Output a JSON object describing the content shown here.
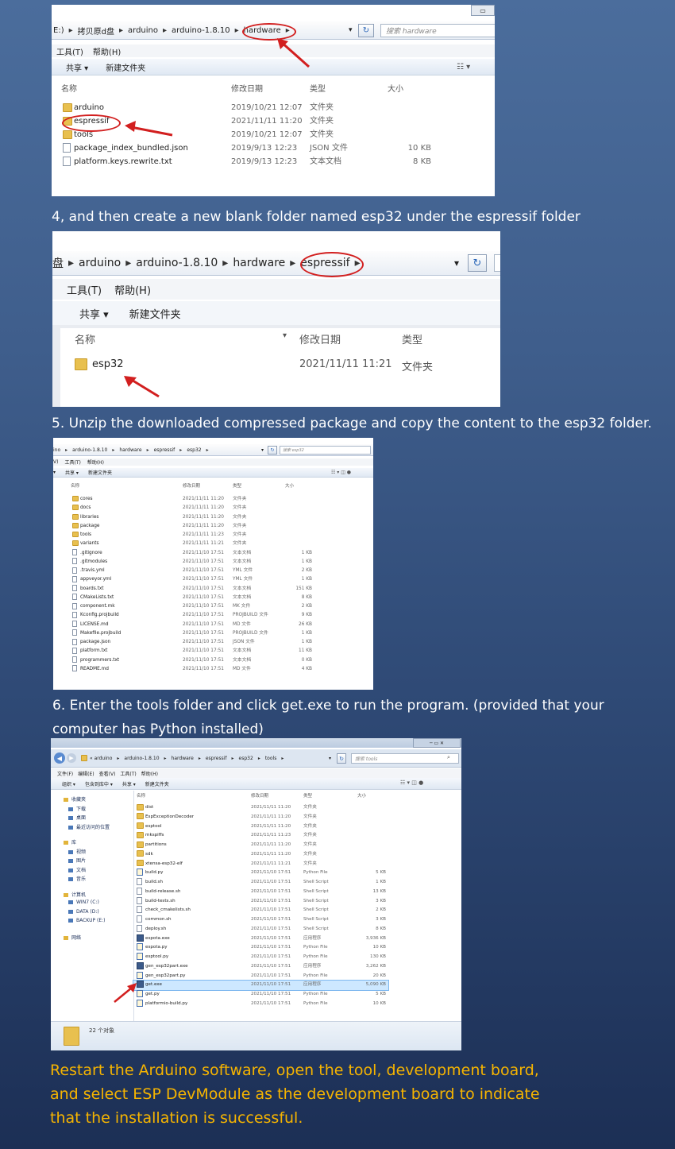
{
  "shot1": {
    "crumbs": [
      "E:)",
      "拷贝原d盘",
      "arduino",
      "arduino-1.8.10",
      "hardware"
    ],
    "search_placeholder": "搜索 hardware",
    "menu": [
      "工具(T)",
      "帮助(H)"
    ],
    "toolbar": [
      "共享 ▾",
      "新建文件夹"
    ],
    "columns": [
      "名称",
      "修改日期",
      "类型",
      "大小"
    ],
    "rows": [
      {
        "name": "arduino",
        "date": "2019/10/21 12:07",
        "type": "文件夹",
        "size": "",
        "kind": "folder"
      },
      {
        "name": "espressif",
        "date": "2021/11/11 11:20",
        "type": "文件夹",
        "size": "",
        "kind": "folder"
      },
      {
        "name": "tools",
        "date": "2019/10/21 12:07",
        "type": "文件夹",
        "size": "",
        "kind": "folder"
      },
      {
        "name": "package_index_bundled.json",
        "date": "2019/9/13 12:23",
        "type": "JSON 文件",
        "size": "10 KB",
        "kind": "file"
      },
      {
        "name": "platform.keys.rewrite.txt",
        "date": "2019/9/13 12:23",
        "type": "文本文档",
        "size": "8 KB",
        "kind": "file"
      }
    ]
  },
  "caption1": "4, and then create a new blank folder named esp32 under the espressif folder",
  "shot2": {
    "crumbs": [
      "盘",
      "arduino",
      "arduino-1.8.10",
      "hardware",
      "espressif"
    ],
    "menu": [
      "工具(T)",
      "帮助(H)"
    ],
    "toolbar": [
      "共享 ▾",
      "新建文件夹"
    ],
    "columns": [
      "名称",
      "修改日期",
      "类型"
    ],
    "rows": [
      {
        "name": "esp32",
        "date": "2021/11/11 11:21",
        "type": "文件夹"
      }
    ]
  },
  "caption2": "5. Unzip the downloaded compressed package and copy the content to the esp32 folder.",
  "shot3": {
    "crumbs": [
      "ino",
      "arduino-1.8.10",
      "hardware",
      "espressif",
      "esp32"
    ],
    "search_placeholder": "搜索 esp32",
    "menu": [
      "V)",
      "工具(T)",
      "帮助(H)"
    ],
    "toolbar": [
      "▾",
      "共享 ▾",
      "新建文件夹"
    ],
    "columns": [
      "名称",
      "修改日期",
      "类型",
      "大小"
    ],
    "rows": [
      {
        "name": "cores",
        "date": "2021/11/11 11:20",
        "type": "文件夹",
        "size": "",
        "kind": "folder"
      },
      {
        "name": "docs",
        "date": "2021/11/11 11:20",
        "type": "文件夹",
        "size": "",
        "kind": "folder"
      },
      {
        "name": "libraries",
        "date": "2021/11/11 11:20",
        "type": "文件夹",
        "size": "",
        "kind": "folder"
      },
      {
        "name": "package",
        "date": "2021/11/11 11:20",
        "type": "文件夹",
        "size": "",
        "kind": "folder"
      },
      {
        "name": "tools",
        "date": "2021/11/11 11:23",
        "type": "文件夹",
        "size": "",
        "kind": "folder"
      },
      {
        "name": "variants",
        "date": "2021/11/11 11:21",
        "type": "文件夹",
        "size": "",
        "kind": "folder"
      },
      {
        "name": ".gitignore",
        "date": "2021/11/10 17:51",
        "type": "文本文档",
        "size": "1 KB",
        "kind": "file"
      },
      {
        "name": ".gitmodules",
        "date": "2021/11/10 17:51",
        "type": "文本文档",
        "size": "1 KB",
        "kind": "file"
      },
      {
        "name": ".travis.yml",
        "date": "2021/11/10 17:51",
        "type": "YML 文件",
        "size": "2 KB",
        "kind": "file"
      },
      {
        "name": "appveyor.yml",
        "date": "2021/11/10 17:51",
        "type": "YML 文件",
        "size": "1 KB",
        "kind": "file"
      },
      {
        "name": "boards.txt",
        "date": "2021/11/10 17:51",
        "type": "文本文档",
        "size": "151 KB",
        "kind": "file"
      },
      {
        "name": "CMakeLists.txt",
        "date": "2021/11/10 17:51",
        "type": "文本文档",
        "size": "8 KB",
        "kind": "file"
      },
      {
        "name": "component.mk",
        "date": "2021/11/10 17:51",
        "type": "MK 文件",
        "size": "2 KB",
        "kind": "file"
      },
      {
        "name": "Kconfig.projbuild",
        "date": "2021/11/10 17:51",
        "type": "PROJBUILD 文件",
        "size": "9 KB",
        "kind": "file"
      },
      {
        "name": "LICENSE.md",
        "date": "2021/11/10 17:51",
        "type": "MD 文件",
        "size": "26 KB",
        "kind": "file"
      },
      {
        "name": "Makefile.projbuild",
        "date": "2021/11/10 17:51",
        "type": "PROJBUILD 文件",
        "size": "1 KB",
        "kind": "file"
      },
      {
        "name": "package.json",
        "date": "2021/11/10 17:51",
        "type": "JSON 文件",
        "size": "1 KB",
        "kind": "file"
      },
      {
        "name": "platform.txt",
        "date": "2021/11/10 17:51",
        "type": "文本文档",
        "size": "11 KB",
        "kind": "file"
      },
      {
        "name": "programmers.txt",
        "date": "2021/11/10 17:51",
        "type": "文本文档",
        "size": "0 KB",
        "kind": "file"
      },
      {
        "name": "README.md",
        "date": "2021/11/10 17:51",
        "type": "MD 文件",
        "size": "4 KB",
        "kind": "file"
      }
    ]
  },
  "caption3": "6. Enter the tools folder and click get.exe to run the program. (provided that your computer has Python installed)",
  "shot4": {
    "crumbs": [
      "« arduino",
      "arduino-1.8.10",
      "hardware",
      "espressif",
      "esp32",
      "tools"
    ],
    "search_placeholder": "搜索 tools",
    "menu": [
      "文件(F)",
      "编辑(E)",
      "查看(V)",
      "工具(T)",
      "帮助(H)"
    ],
    "toolbar": [
      "组织 ▾",
      "包含到库中 ▾",
      "共享 ▾",
      "新建文件夹"
    ],
    "columns": [
      "名称",
      "修改日期",
      "类型",
      "大小"
    ],
    "sidebar": [
      {
        "label": "收藏夹",
        "group": true
      },
      {
        "label": "下载",
        "group": false
      },
      {
        "label": "桌面",
        "group": false
      },
      {
        "label": "最近访问的位置",
        "group": false
      },
      {
        "label": "库",
        "group": true
      },
      {
        "label": "视频",
        "group": false
      },
      {
        "label": "图片",
        "group": false
      },
      {
        "label": "文档",
        "group": false
      },
      {
        "label": "音乐",
        "group": false
      },
      {
        "label": "计算机",
        "group": true
      },
      {
        "label": "WIN7 (C:)",
        "group": false
      },
      {
        "label": "DATA (D:)",
        "group": false
      },
      {
        "label": "BACKUP (E:)",
        "group": false
      },
      {
        "label": "网络",
        "group": true
      }
    ],
    "rows": [
      {
        "name": "dist",
        "date": "2021/11/11 11:20",
        "type": "文件夹",
        "size": "",
        "kind": "folder"
      },
      {
        "name": "EspExceptionDecoder",
        "date": "2021/11/11 11:20",
        "type": "文件夹",
        "size": "",
        "kind": "folder"
      },
      {
        "name": "esptool",
        "date": "2021/11/11 11:20",
        "type": "文件夹",
        "size": "",
        "kind": "folder"
      },
      {
        "name": "mkspiffs",
        "date": "2021/11/11 11:23",
        "type": "文件夹",
        "size": "",
        "kind": "folder"
      },
      {
        "name": "partitions",
        "date": "2021/11/11 11:20",
        "type": "文件夹",
        "size": "",
        "kind": "folder"
      },
      {
        "name": "sdk",
        "date": "2021/11/11 11:20",
        "type": "文件夹",
        "size": "",
        "kind": "folder"
      },
      {
        "name": "xtensa-esp32-elf",
        "date": "2021/11/11 11:21",
        "type": "文件夹",
        "size": "",
        "kind": "folder"
      },
      {
        "name": "build.py",
        "date": "2021/11/10 17:51",
        "type": "Python File",
        "size": "5 KB",
        "kind": "py"
      },
      {
        "name": "build.sh",
        "date": "2021/11/10 17:51",
        "type": "Shell Script",
        "size": "1 KB",
        "kind": "file"
      },
      {
        "name": "build-release.sh",
        "date": "2021/11/10 17:51",
        "type": "Shell Script",
        "size": "13 KB",
        "kind": "file"
      },
      {
        "name": "build-tests.sh",
        "date": "2021/11/10 17:51",
        "type": "Shell Script",
        "size": "3 KB",
        "kind": "file"
      },
      {
        "name": "check_cmakelists.sh",
        "date": "2021/11/10 17:51",
        "type": "Shell Script",
        "size": "2 KB",
        "kind": "file"
      },
      {
        "name": "common.sh",
        "date": "2021/11/10 17:51",
        "type": "Shell Script",
        "size": "3 KB",
        "kind": "file"
      },
      {
        "name": "deploy.sh",
        "date": "2021/11/10 17:51",
        "type": "Shell Script",
        "size": "8 KB",
        "kind": "file"
      },
      {
        "name": "espota.exe",
        "date": "2021/11/10 17:51",
        "type": "应用程序",
        "size": "3,936 KB",
        "kind": "exe"
      },
      {
        "name": "espota.py",
        "date": "2021/11/10 17:51",
        "type": "Python File",
        "size": "10 KB",
        "kind": "py"
      },
      {
        "name": "esptool.py",
        "date": "2021/11/10 17:51",
        "type": "Python File",
        "size": "130 KB",
        "kind": "py"
      },
      {
        "name": "gen_esp32part.exe",
        "date": "2021/11/10 17:51",
        "type": "应用程序",
        "size": "3,262 KB",
        "kind": "exe"
      },
      {
        "name": "gen_esp32part.py",
        "date": "2021/11/10 17:51",
        "type": "Python File",
        "size": "20 KB",
        "kind": "py"
      },
      {
        "name": "get.exe",
        "date": "2021/11/10 17:51",
        "type": "应用程序",
        "size": "5,090 KB",
        "kind": "exe",
        "selected": true
      },
      {
        "name": "get.py",
        "date": "2021/11/10 17:51",
        "type": "Python File",
        "size": "5 KB",
        "kind": "py"
      },
      {
        "name": "platformio-build.py",
        "date": "2021/11/10 17:51",
        "type": "Python File",
        "size": "10 KB",
        "kind": "py"
      }
    ],
    "status": "22 个对象"
  },
  "final_text": "Restart the Arduino software, open the tool, development board, and select ESP DevModule as the development board to indicate that the installation is successful.",
  "colors": {
    "highlight": "#d21f1f",
    "accent_text": "#f6b400",
    "selection": "#cde8ff"
  }
}
